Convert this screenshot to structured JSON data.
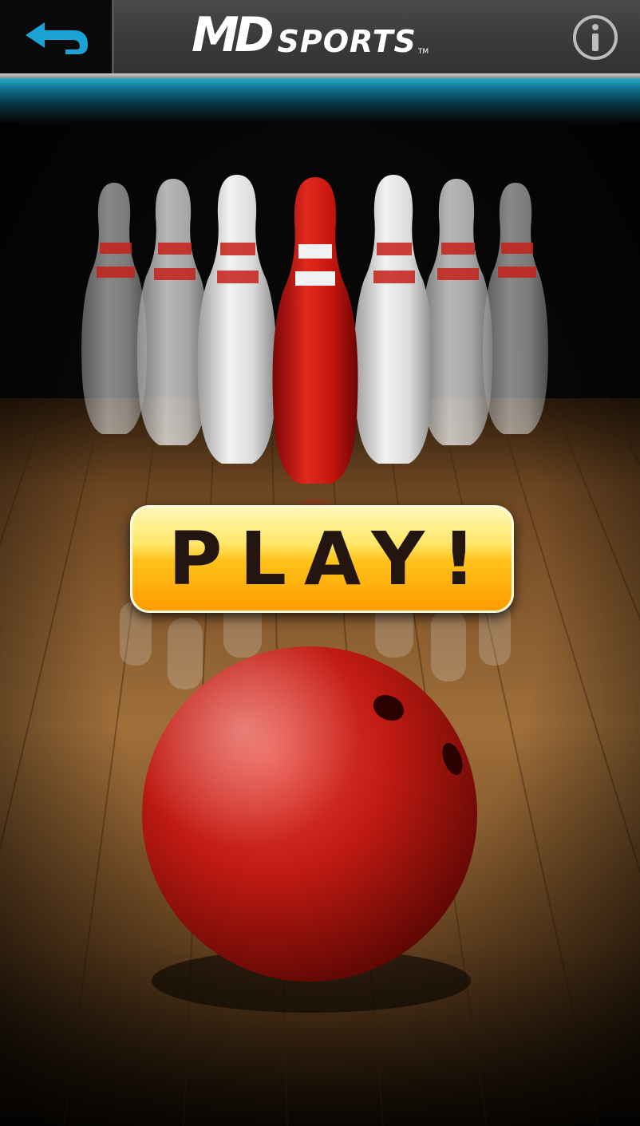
{
  "header": {
    "logo_md": "MD",
    "logo_sports": "SPORTS",
    "logo_tm": "TM",
    "back_icon": "back-arrow-icon",
    "info_icon": "info-icon"
  },
  "main": {
    "play_label": "PLAY!"
  },
  "colors": {
    "accent": "#1aa3d4",
    "play_button_top": "#ffe76a",
    "play_button_bottom": "#ff9d00",
    "ball": "#c51a12",
    "head_pin": "#c8140e"
  }
}
